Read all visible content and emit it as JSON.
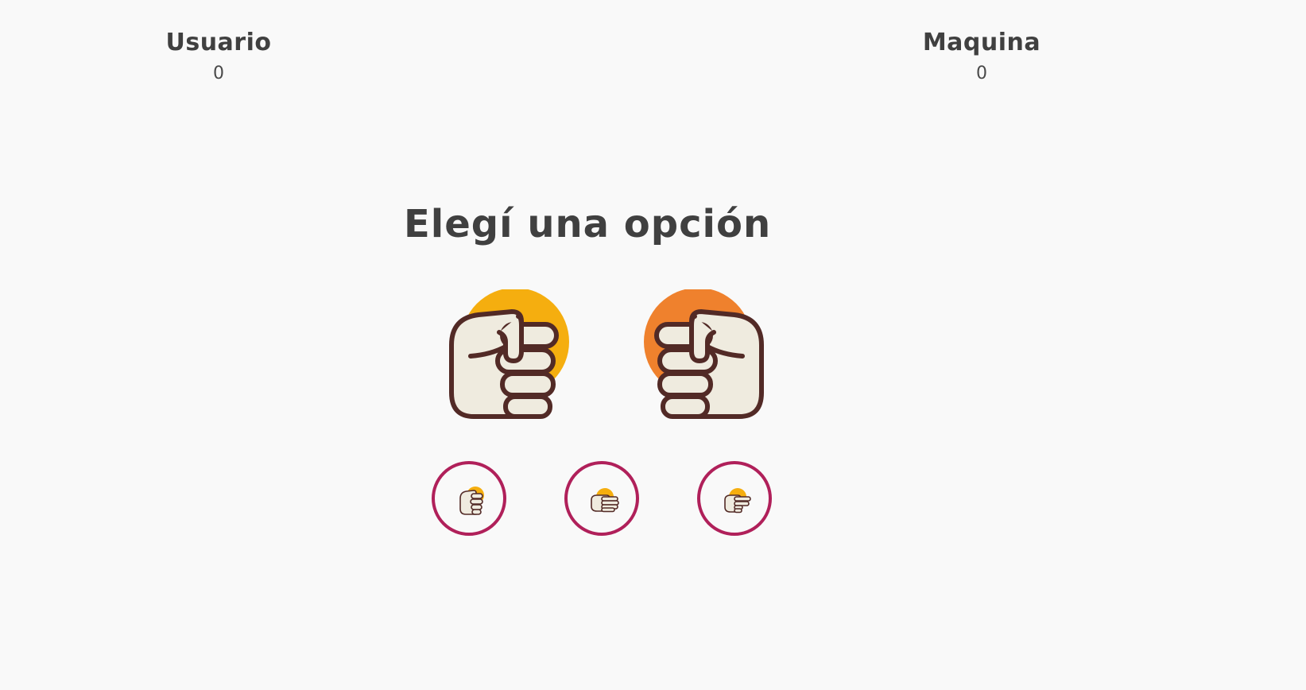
{
  "scoreboard": {
    "user": {
      "label": "Usuario",
      "score": "0"
    },
    "machine": {
      "label": "Maquina",
      "score": "0"
    }
  },
  "heading": "Elegí una opción",
  "current_picks": {
    "user": {
      "icon": "rock-fist-icon",
      "accent": "#f5ae0f"
    },
    "machine": {
      "icon": "rock-fist-icon",
      "accent": "#ef812d"
    }
  },
  "options": [
    {
      "icon": "rock-icon",
      "accent": "#f5ae0f"
    },
    {
      "icon": "paper-icon",
      "accent": "#f5ae0f"
    },
    {
      "icon": "scissors-icon",
      "accent": "#f5ae0f"
    }
  ],
  "colors": {
    "background": "#f9f9f9",
    "text": "#404040",
    "option_border": "#b0205a",
    "hand_fill": "#efebdf",
    "hand_outline": "#522a26"
  }
}
